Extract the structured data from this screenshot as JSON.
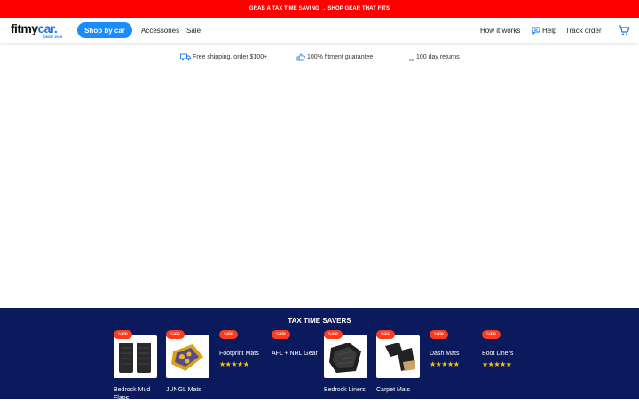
{
  "promo": {
    "text": "GRAB A TAX TIME SAVING → SHOP GEAR THAT FITS"
  },
  "header": {
    "logo": {
      "fit": "fit",
      "my": "my",
      "car": "car.",
      "tag": "SINCE 2015"
    },
    "shop_button": "Shop by car",
    "nav_left": [
      "Accessories",
      "Sale"
    ],
    "nav_right": {
      "how": "How it works",
      "help": "Help",
      "track": "Track order"
    },
    "cart_icon": "cart-icon"
  },
  "usps": [
    {
      "icon": "truck-icon",
      "text": "Free shipping, order $100+"
    },
    {
      "icon": "thumbs-up-icon",
      "text": "100% fitment guarantee"
    },
    {
      "icon": "return-icon",
      "text": "100 day returns"
    }
  ],
  "band": {
    "title": "TAX TIME SAVERS",
    "cards": [
      {
        "badge": "sale",
        "label": "Bedrock Mud Flaps",
        "stars": "",
        "has_image": true
      },
      {
        "badge": "sale",
        "label": "JUNGL Mats",
        "stars": "",
        "has_image": true
      },
      {
        "badge": "sale",
        "label": "Footprint Mats",
        "stars": "★★★★★",
        "has_image": false
      },
      {
        "badge": "sale",
        "label": "AFL + NRL Gear",
        "stars": "",
        "has_image": false
      },
      {
        "badge": "sale",
        "label": "Bedrock Liners",
        "stars": "",
        "has_image": true
      },
      {
        "badge": "sale",
        "label": "Carpet Mats",
        "stars": "",
        "has_image": true
      },
      {
        "badge": "sale",
        "label": "Dash Mats",
        "stars": "★★★★★",
        "has_image": false
      },
      {
        "badge": "sale",
        "label": "Boot Liners",
        "stars": "★★★★★",
        "has_image": false
      }
    ]
  },
  "colors": {
    "promo": "#ff0000",
    "brand_blue": "#1a8cff",
    "band": "#0b1a5c",
    "badge": "#ff3b1f",
    "stars": "#ffc400"
  }
}
